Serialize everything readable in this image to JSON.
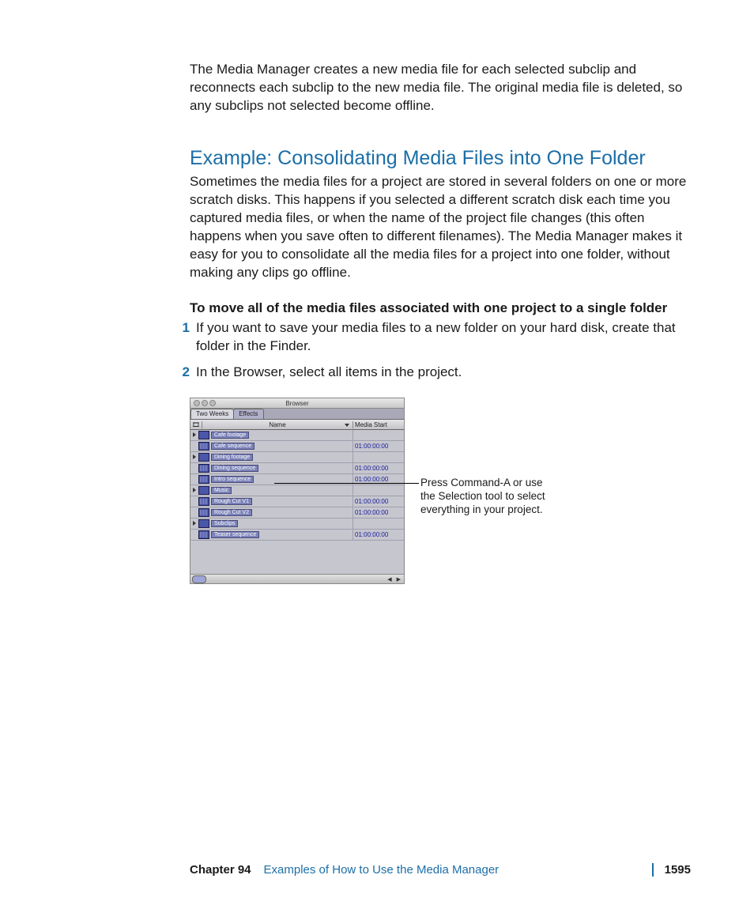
{
  "intro_para": "The Media Manager creates a new media file for each selected subclip and reconnects each subclip to the new media file. The original media file is deleted, so any subclips not selected become offline.",
  "heading": "Example: Consolidating Media Files into One Folder",
  "heading_para": "Sometimes the media files for a project are stored in several folders on one or more scratch disks. This happens if you selected a different scratch disk each time you captured media files, or when the name of the project file changes (this often happens when you save often to different filenames). The Media Manager makes it easy for you to consolidate all the media files for a project into one folder, without making any clips go offline.",
  "task_intro": "To move all of the media files associated with one project to a single folder",
  "steps": [
    "If you want to save your media files to a new folder on your hard disk, create that folder in the Finder.",
    "In the Browser, select all items in the project."
  ],
  "browser": {
    "title": "Browser",
    "tabs": [
      "Two Weeks",
      "Effects"
    ],
    "columns": {
      "name": "Name",
      "media_start": "Media Start"
    },
    "rows": [
      {
        "arrow": true,
        "type": "bin",
        "label": "Cafe footage",
        "media_start": ""
      },
      {
        "arrow": false,
        "type": "seq",
        "label": "Cafe sequence",
        "media_start": "01:00:00:00"
      },
      {
        "arrow": true,
        "type": "bin",
        "label": "Dining footage",
        "media_start": ""
      },
      {
        "arrow": false,
        "type": "seq",
        "label": "Dining sequence",
        "media_start": "01:00:00:00"
      },
      {
        "arrow": false,
        "type": "seq",
        "label": "Intro sequence",
        "media_start": "01:00:00:00"
      },
      {
        "arrow": true,
        "type": "bin",
        "label": "Music",
        "media_start": ""
      },
      {
        "arrow": false,
        "type": "seq",
        "label": "Rough Cut V1",
        "media_start": "01:00:00:00"
      },
      {
        "arrow": false,
        "type": "seq",
        "label": "Rough Cut V2",
        "media_start": "01:00:00:00"
      },
      {
        "arrow": true,
        "type": "bin",
        "label": "Subclips",
        "media_start": ""
      },
      {
        "arrow": false,
        "type": "seq",
        "label": "Teaser sequence",
        "media_start": "01:00:00:00"
      }
    ]
  },
  "callout": "Press Command-A or use the Selection tool to select everything in your project.",
  "footer": {
    "chapter": "Chapter 94",
    "title": "Examples of How to Use the Media Manager",
    "page": "1595"
  }
}
